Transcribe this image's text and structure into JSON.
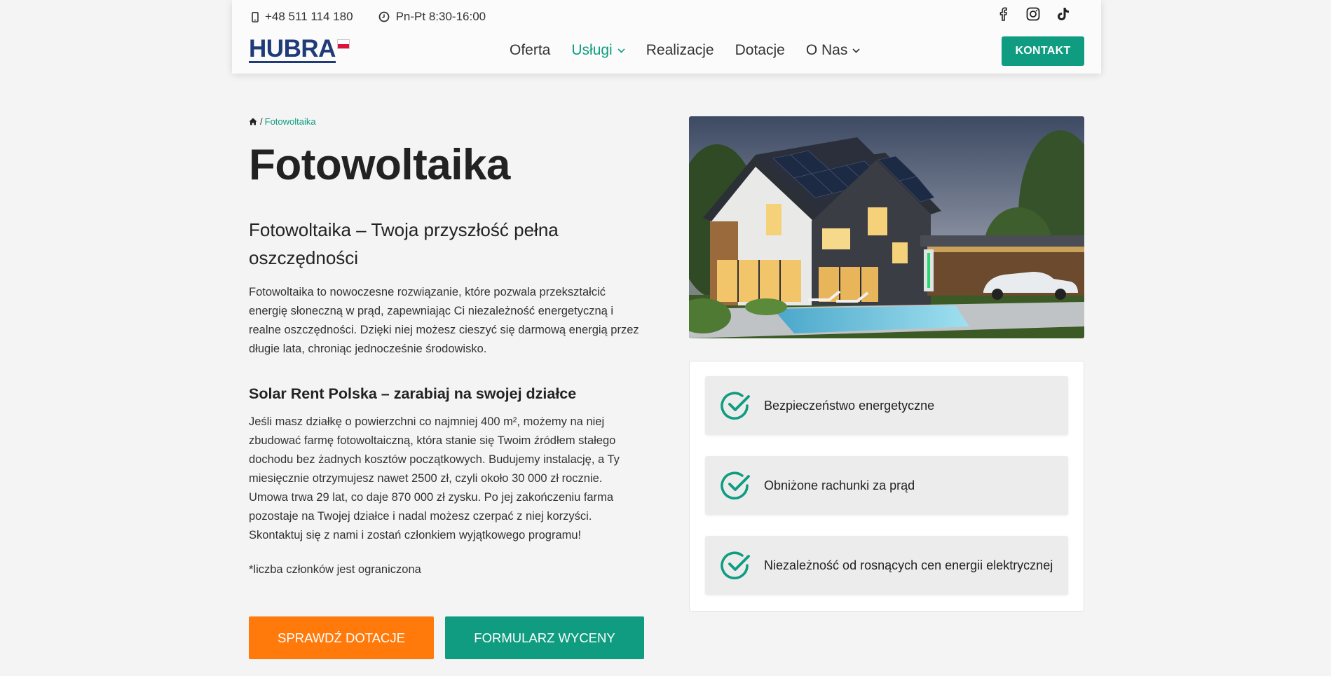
{
  "topbar": {
    "phone": "+48 511 114 180",
    "hours": "Pn-Pt 8:30-16:00",
    "socials": [
      "facebook-icon",
      "instagram-icon",
      "tiktok-icon"
    ]
  },
  "logo": {
    "text_h": "H",
    "text_u": "U",
    "text_rest": "BRA"
  },
  "nav": {
    "items": [
      {
        "label": "Oferta",
        "dropdown": false,
        "active": false
      },
      {
        "label": "Usługi",
        "dropdown": true,
        "active": true
      },
      {
        "label": "Realizacje",
        "dropdown": false,
        "active": false
      },
      {
        "label": "Dotacje",
        "dropdown": false,
        "active": false
      },
      {
        "label": "O Nas",
        "dropdown": true,
        "active": false
      }
    ],
    "cta": "KONTAKT"
  },
  "breadcrumb": {
    "separator": "/",
    "current": "Fotowoltaika"
  },
  "page": {
    "title": "Fotowoltaika",
    "subtitle": "Fotowoltaika – Twoja przyszłość pełna oszczędności",
    "intro": "Fotowoltaika to nowoczesne rozwiązanie, które pozwala przekształcić energię słoneczną w prąd, zapewniając Ci niezależność energetyczną i realne oszczędności. Dzięki niej możesz cieszyć się darmową energią przez długie lata, chroniąc jednocześnie środowisko.",
    "section_title": "Solar Rent Polska – zarabiaj na swojej działce",
    "section_text": "Jeśli masz działkę o powierzchni co najmniej 400 m², możemy na niej zbudować farmę fotowoltaiczną, która stanie się Twoim źródłem stałego dochodu bez żadnych kosztów początkowych. Budujemy instalację, a Ty miesięcznie otrzymujesz nawet 2500 zł, czyli około 30 000 zł rocznie. Umowa trwa 29 lat, co daje 870 000 zł zysku. Po jej zakończeniu farma pozostaje na Twojej działce i nadal możesz czerpać z niej korzyści. Skontaktuj się z nami i zostań członkiem wyjątkowego programu!",
    "note": "*liczba członków jest ograniczona"
  },
  "buttons": {
    "primary": "SPRAWDŹ DOTACJE",
    "secondary": "FORMULARZ WYCENY"
  },
  "features": [
    "Bezpieczeństwo energetyczne",
    "Obniżone rachunki za prąd",
    "Niezależność od rosnących cen energii elektrycznej"
  ],
  "colors": {
    "accent": "#0f9c80",
    "orange": "#ff7a0a",
    "logo_blue": "#1f3b78"
  }
}
